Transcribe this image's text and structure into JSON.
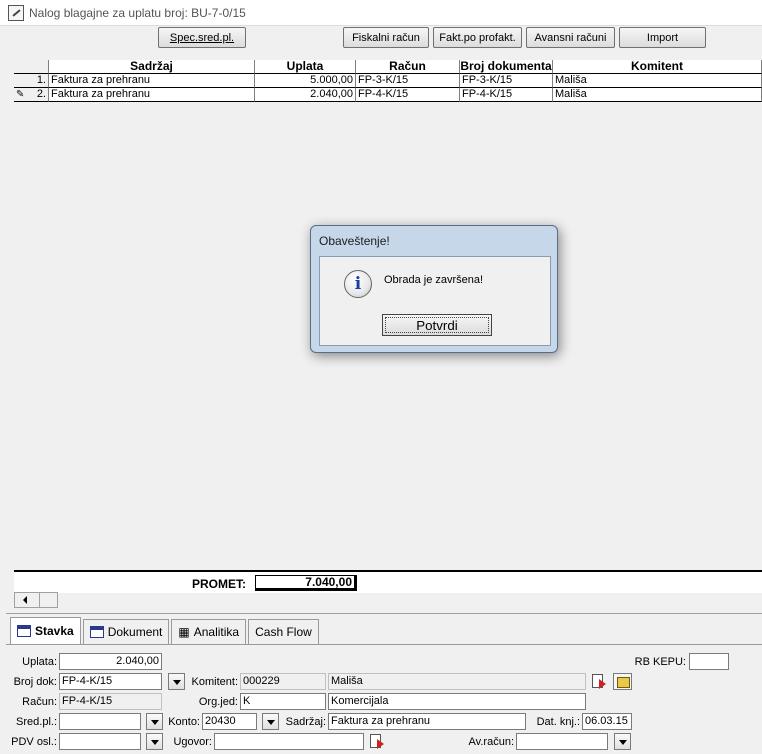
{
  "window": {
    "title": "Nalog blagajne za uplatu broj: BU-7-0/15"
  },
  "toolbar": {
    "spec_label": "Spec.sred.pl.",
    "fiskalni_label": "Fiskalni račun",
    "fakt_label": "Fakt.po profakt.",
    "avansni_label": "Avansni računi",
    "import_label": "Import"
  },
  "grid": {
    "headers": {
      "sadrzaj": "Sadržaj",
      "uplata": "Uplata",
      "racun": "Račun",
      "broj": "Broj dokumenta",
      "komitent": "Komitent"
    },
    "rows": [
      {
        "rn": "1.",
        "sadrzaj": "Faktura za prehranu",
        "uplata": "5.000,00",
        "racun": "FP-3-K/15",
        "broj": "FP-3-K/15",
        "komitent": "Mališa"
      },
      {
        "rn": "2.",
        "sadrzaj": "Faktura za prehranu",
        "uplata": "2.040,00",
        "racun": "FP-4-K/15",
        "broj": "FP-4-K/15",
        "komitent": "Mališa"
      }
    ]
  },
  "dialog": {
    "title": "Obaveštenje!",
    "message": "Obrada je završena!",
    "ok_label": "Potvrdi"
  },
  "summary": {
    "promet_label": "PROMET:",
    "promet_value": "7.040,00"
  },
  "tabs": [
    {
      "label": "Stavka",
      "icon": "window-icon",
      "active": true
    },
    {
      "label": "Dokument",
      "icon": "document-list-icon",
      "active": false
    },
    {
      "label": "Analitika",
      "icon": "analytics-icon",
      "active": false
    },
    {
      "label": "Cash Flow",
      "icon": "",
      "active": false
    }
  ],
  "form": {
    "uplata_label": "Uplata:",
    "uplata_value": "2.040,00",
    "rb_kepu_label": "RB KEPU:",
    "rb_kepu_value": "",
    "broj_dok_label": "Broj dok:",
    "broj_dok_value": "FP-4-K/15",
    "komitent_label": "Komitent:",
    "komitent_code": "000229",
    "komitent_name": "Mališa",
    "racun_label": "Račun:",
    "racun_value": "FP-4-K/15",
    "org_jed_label": "Org.jed:",
    "org_jed_code": "K",
    "org_jed_name": "Komercijala",
    "sred_pl_label": "Sred.pl.:",
    "sred_pl_value": "",
    "konto_label": "Konto:",
    "konto_value": "20430",
    "sadrzaj_label": "Sadržaj:",
    "sadrzaj_value": "Faktura za prehranu",
    "dat_knj_label": "Dat. knj.:",
    "dat_knj_value": "06.03.15",
    "pdv_label": "PDV osl.:",
    "pdv_value": "",
    "ugovor_label": "Ugovor:",
    "ugovor_value": "",
    "av_racun_label": "Av.račun:",
    "av_racun_value": ""
  }
}
